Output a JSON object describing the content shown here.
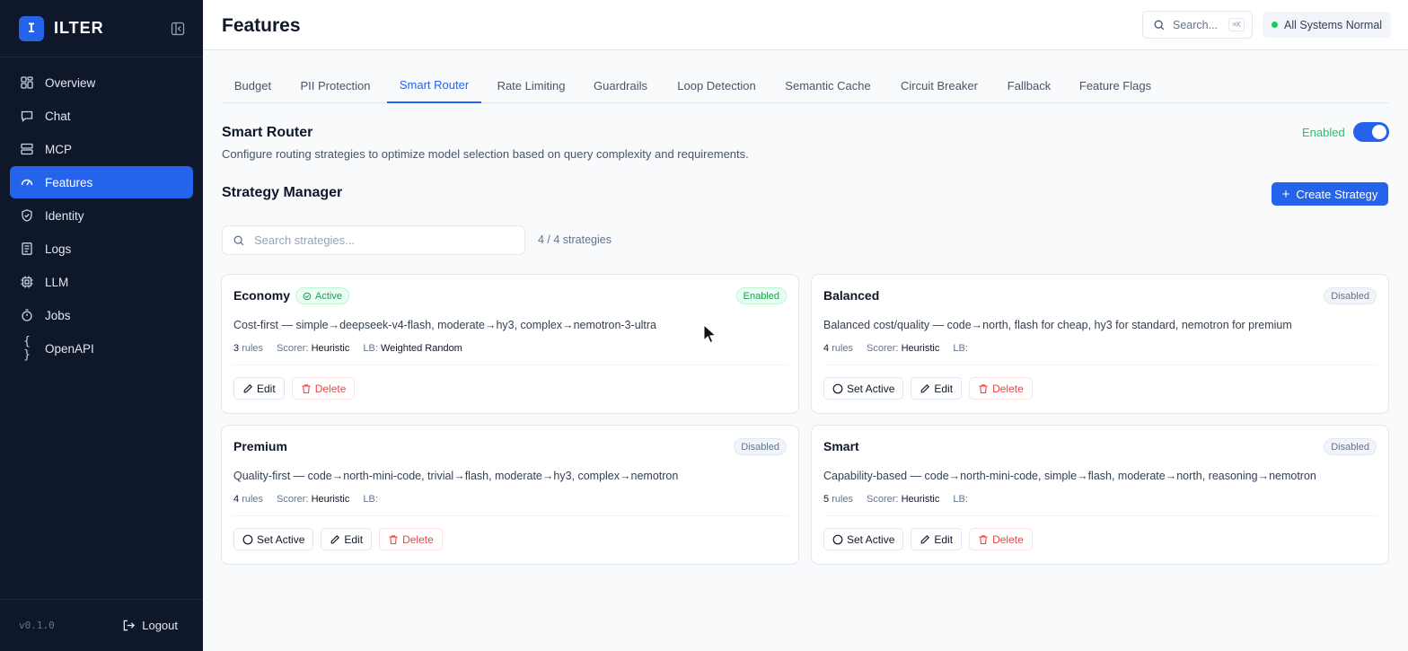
{
  "brand": {
    "initial": "I",
    "name": "ILTER"
  },
  "sidebar": {
    "items": [
      {
        "label": "Overview",
        "icon": "grid-icon"
      },
      {
        "label": "Chat",
        "icon": "chat-icon"
      },
      {
        "label": "MCP",
        "icon": "server-icon"
      },
      {
        "label": "Features",
        "icon": "gauge-icon",
        "active": true
      },
      {
        "label": "Identity",
        "icon": "shield-icon"
      },
      {
        "label": "Logs",
        "icon": "log-icon"
      },
      {
        "label": "LLM",
        "icon": "chip-icon"
      },
      {
        "label": "Jobs",
        "icon": "timer-icon"
      },
      {
        "label": "OpenAPI",
        "icon": "braces-icon",
        "glyph": "{ }"
      }
    ],
    "version": "v0.1.0",
    "logout_label": "Logout"
  },
  "header": {
    "title": "Features",
    "search_label": "Search...",
    "search_shortcut": "⌘K",
    "status": "All Systems Normal"
  },
  "tabs": [
    {
      "label": "Budget"
    },
    {
      "label": "PII Protection"
    },
    {
      "label": "Smart Router",
      "active": true
    },
    {
      "label": "Rate Limiting"
    },
    {
      "label": "Guardrails"
    },
    {
      "label": "Loop Detection"
    },
    {
      "label": "Semantic Cache"
    },
    {
      "label": "Circuit Breaker"
    },
    {
      "label": "Fallback"
    },
    {
      "label": "Feature Flags"
    }
  ],
  "section": {
    "title": "Smart Router",
    "description": "Configure routing strategies to optimize model selection based on query complexity and requirements.",
    "enabled_label": "Enabled",
    "enabled": true
  },
  "manager": {
    "title": "Strategy Manager",
    "create_label": "Create Strategy",
    "search_placeholder": "Search strategies...",
    "count": "4 / 4 strategies"
  },
  "labels": {
    "rules": "rules",
    "scorer": "Scorer:",
    "lb": "LB:",
    "set_active": "Set Active",
    "edit": "Edit",
    "delete": "Delete",
    "active_badge": "Active"
  },
  "strategies": [
    {
      "name": "Economy",
      "active": true,
      "status": "Enabled",
      "description": "Cost-first — simple→deepseek-v4-flash, moderate→hy3, complex→nemotron-3-ultra",
      "rules": "3",
      "scorer": "Heuristic",
      "lb": "Weighted Random"
    },
    {
      "name": "Balanced",
      "active": false,
      "status": "Disabled",
      "description": "Balanced cost/quality — code→north, flash for cheap, hy3 for standard, nemotron for premium",
      "rules": "4",
      "scorer": "Heuristic",
      "lb": ""
    },
    {
      "name": "Premium",
      "active": false,
      "status": "Disabled",
      "description": "Quality-first — code→north-mini-code, trivial→flash, moderate→hy3, complex→nemotron",
      "rules": "4",
      "scorer": "Heuristic",
      "lb": ""
    },
    {
      "name": "Smart",
      "active": false,
      "status": "Disabled",
      "description": "Capability-based — code→north-mini-code, simple→flash, moderate→north, reasoning→nemotron",
      "rules": "5",
      "scorer": "Heuristic",
      "lb": ""
    }
  ],
  "colors": {
    "accent": "#2563eb",
    "sidebar_bg": "#0f172a",
    "success": "#22c55e",
    "danger": "#ef4444"
  }
}
